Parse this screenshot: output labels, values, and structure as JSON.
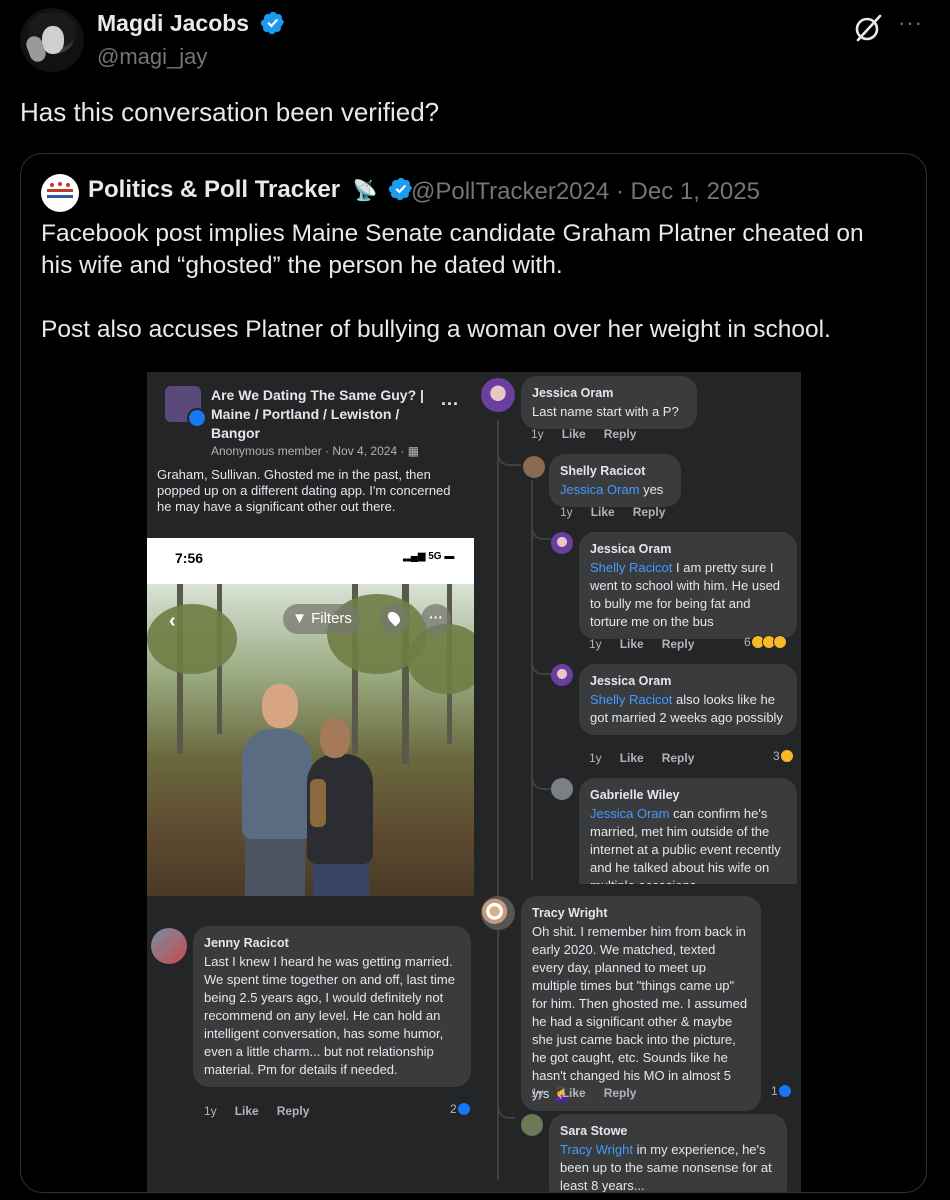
{
  "tweet": {
    "author_name": "Magdi Jacobs",
    "author_handle": "@magi_jay",
    "text": "Has this conversation been verified?",
    "more": "···"
  },
  "quote": {
    "name": "Politics & Poll Tracker",
    "meta": "@PollTracker2024 · Dec 1, 2025",
    "text_p1": "Facebook post implies Maine Senate candidate Graham Platner cheated on his wife and “ghosted” the person he dated with.",
    "text_p2": "Post also accuses Platner of bullying a woman over her weight in school."
  },
  "screenshot": {
    "group_title": "Are We Dating The Same Guy? | Maine / Portland / Lewiston / Bangor",
    "group_meta": "Anonymous member · Nov 4, 2024 · ",
    "group_more": "···",
    "post_text": "Graham, Sullivan. Ghosted me in the past, then popped up on a different dating app. I'm concerned he may have a significant other out there.",
    "phone_time": "7:56",
    "phone_status": "5G",
    "filters_label": "Filters",
    "back_glyph": "‹",
    "dots_glyph": "···",
    "action_time": "1y",
    "action_like": "Like",
    "action_reply": "Reply",
    "comments": {
      "c1": {
        "name": "Jessica Oram",
        "text": "Last name start with a P?"
      },
      "c2": {
        "name": "Shelly Racicot",
        "mention": "Jessica Oram",
        "text": " yes"
      },
      "c3": {
        "name": "Jessica Oram",
        "mention": "Shelly Racicot",
        "text": " I am pretty sure I went to school with him. He used to bully me for being fat and torture me on the bus",
        "reactions": "6"
      },
      "c4": {
        "name": "Jessica Oram",
        "mention": "Shelly Racicot",
        "text": " also looks like he got married 2 weeks ago possibly",
        "reactions": "3"
      },
      "c5": {
        "name": "Gabrielle Wiley",
        "mention": "Jessica Oram",
        "text": " can confirm he's married, met him outside of the internet at a public event recently and he talked about his wife on multiple occasions"
      },
      "c6": {
        "name": "Jenny Racicot",
        "text": "Last I knew I heard he was getting married. We spent time together on and off, last time being 2.5 years ago, I would definitely not recommend on any level. He can hold an intelligent conversation, has some humor, even a little charm... but not relationship material. Pm for details if needed.",
        "reactions": "2"
      },
      "c7": {
        "name": "Tracy Wright",
        "text": "Oh shit. I remember him from back in early 2020. We matched, texted every day, planned to meet up multiple times but \"things came up\" for him. Then ghosted me. I assumed he had a significant other & maybe she just came back into the picture, he got caught, etc. Sounds like he hasn't changed his MO in almost 5 yrs 🤦‍♀️",
        "reactions": "1"
      },
      "c8": {
        "name": "Sara Stowe",
        "mention": "Tracy Wright",
        "text": " in my experience, he's been up to the same nonsense for at least 8 years..."
      }
    }
  },
  "colors": {
    "background": "#000000",
    "text": "#e7e9ea",
    "muted": "#71767b",
    "verified_blue": "#1d9bf0",
    "fb_link": "#4599ff",
    "fb_bubble": "#3a3b3c"
  }
}
